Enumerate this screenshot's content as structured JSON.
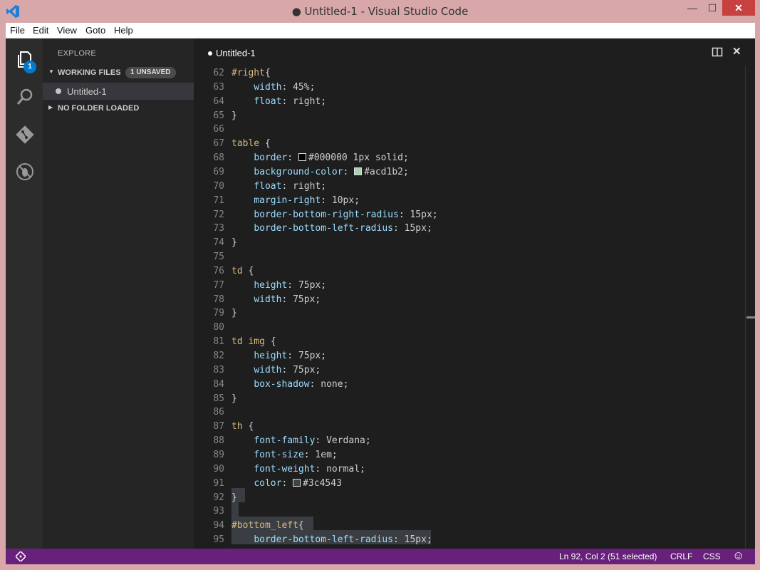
{
  "window": {
    "title": "● Untitled-1 - Visual Studio Code",
    "minimize": "—",
    "maximize": "☐",
    "close": "✕"
  },
  "menu": [
    "File",
    "Edit",
    "View",
    "Goto",
    "Help"
  ],
  "activity": {
    "explorer_badge": "1",
    "icons": [
      "files-icon",
      "search-icon",
      "git-icon",
      "debug-icon"
    ]
  },
  "sidebar": {
    "title": "EXPLORE",
    "working_files_label": "WORKING FILES",
    "unsaved_badge": "1 UNSAVED",
    "file_name": "Untitled-1",
    "no_folder_label": "NO FOLDER LOADED"
  },
  "editor": {
    "tab_title": "Untitled-1",
    "lines": [
      {
        "n": "62",
        "t": "#right{"
      },
      {
        "n": "63",
        "t": "    width: 45%;"
      },
      {
        "n": "64",
        "t": "    float: right;"
      },
      {
        "n": "65",
        "t": "}"
      },
      {
        "n": "66",
        "t": ""
      },
      {
        "n": "67",
        "t": "table {"
      },
      {
        "n": "68",
        "t": "    border: #000000 1px solid;"
      },
      {
        "n": "69",
        "t": "    background-color: #acd1b2;"
      },
      {
        "n": "70",
        "t": "    float: right;"
      },
      {
        "n": "71",
        "t": "    margin-right: 10px;"
      },
      {
        "n": "72",
        "t": "    border-bottom-right-radius: 15px;"
      },
      {
        "n": "73",
        "t": "    border-bottom-left-radius: 15px;"
      },
      {
        "n": "74",
        "t": "}"
      },
      {
        "n": "75",
        "t": ""
      },
      {
        "n": "76",
        "t": "td {"
      },
      {
        "n": "77",
        "t": "    height: 75px;"
      },
      {
        "n": "78",
        "t": "    width: 75px;"
      },
      {
        "n": "79",
        "t": "}"
      },
      {
        "n": "80",
        "t": ""
      },
      {
        "n": "81",
        "t": "td img {"
      },
      {
        "n": "82",
        "t": "    height: 75px;"
      },
      {
        "n": "83",
        "t": "    width: 75px;"
      },
      {
        "n": "84",
        "t": "    box-shadow: none;"
      },
      {
        "n": "85",
        "t": "}"
      },
      {
        "n": "86",
        "t": ""
      },
      {
        "n": "87",
        "t": "th {"
      },
      {
        "n": "88",
        "t": "    font-family: Verdana;"
      },
      {
        "n": "89",
        "t": "    font-size: 1em;"
      },
      {
        "n": "90",
        "t": "    font-weight: normal;"
      },
      {
        "n": "91",
        "t": "    color: #3c4543"
      },
      {
        "n": "92",
        "t": "}"
      },
      {
        "n": "93",
        "t": ""
      },
      {
        "n": "94",
        "t": "#bottom_left{"
      },
      {
        "n": "95",
        "t": "    border-bottom-left-radius: 15px;"
      }
    ]
  },
  "swatch_colors": {
    "68": "#000000",
    "69": "#acd1b2",
    "91": "#3c4543"
  },
  "status": {
    "position": "Ln 92, Col 2 (51 selected)",
    "eol": "CRLF",
    "language": "CSS",
    "feedback": "☺"
  },
  "colors": {
    "statusbar": "#68217a",
    "accent": "#007acc"
  }
}
